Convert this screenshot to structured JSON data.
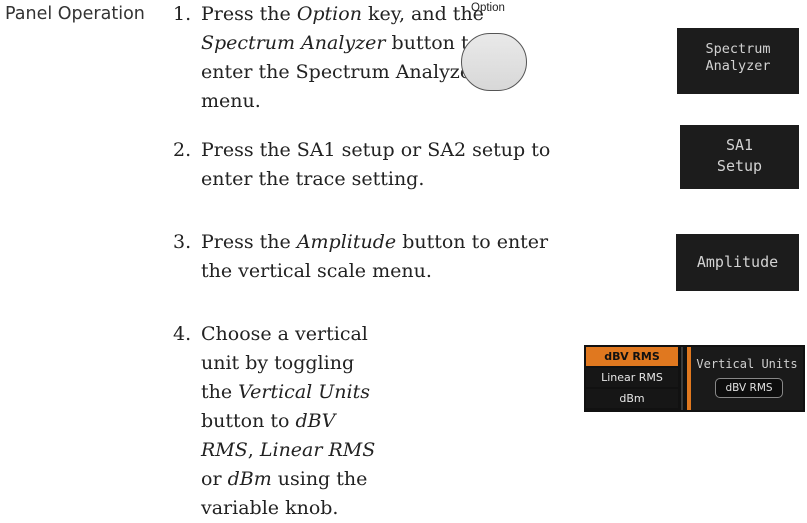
{
  "section": {
    "label": "Panel Operation"
  },
  "steps": [
    {
      "number": "1.",
      "parts": [
        "Press the ",
        "Option",
        " key, and the ",
        "Spectrum Analyzer",
        " button to enter the Spectrum Analyzer menu."
      ]
    },
    {
      "number": "2.",
      "parts": [
        "Press the SA1 setup or SA2 setup to enter the trace setting."
      ]
    },
    {
      "number": "3.",
      "parts": [
        "Press the ",
        "Amplitude",
        " button to enter the vertical scale menu."
      ]
    },
    {
      "number": "4.",
      "parts": [
        "Choose a vertical unit by toggling the ",
        "Vertical Units",
        " button to ",
        "dBV RMS",
        ", ",
        "Linear RMS",
        " or ",
        "dBm",
        " using the variable knob."
      ]
    }
  ],
  "option_key": {
    "label": "Option"
  },
  "softkeys": {
    "spectrum_analyzer": {
      "line1": "Spectrum",
      "line2": "Analyzer"
    },
    "sa1_setup": {
      "line1": "SA1",
      "line2": "Setup"
    },
    "amplitude": {
      "label": "Amplitude"
    }
  },
  "vertical_units_menu": {
    "options": [
      "dBV RMS",
      "Linear RMS",
      "dBm"
    ],
    "selected": "dBV RMS",
    "title": "Vertical Units",
    "value": "dBV RMS"
  },
  "colors": {
    "accent": "#e0781f",
    "softkey_bg": "#1c1c1c"
  }
}
